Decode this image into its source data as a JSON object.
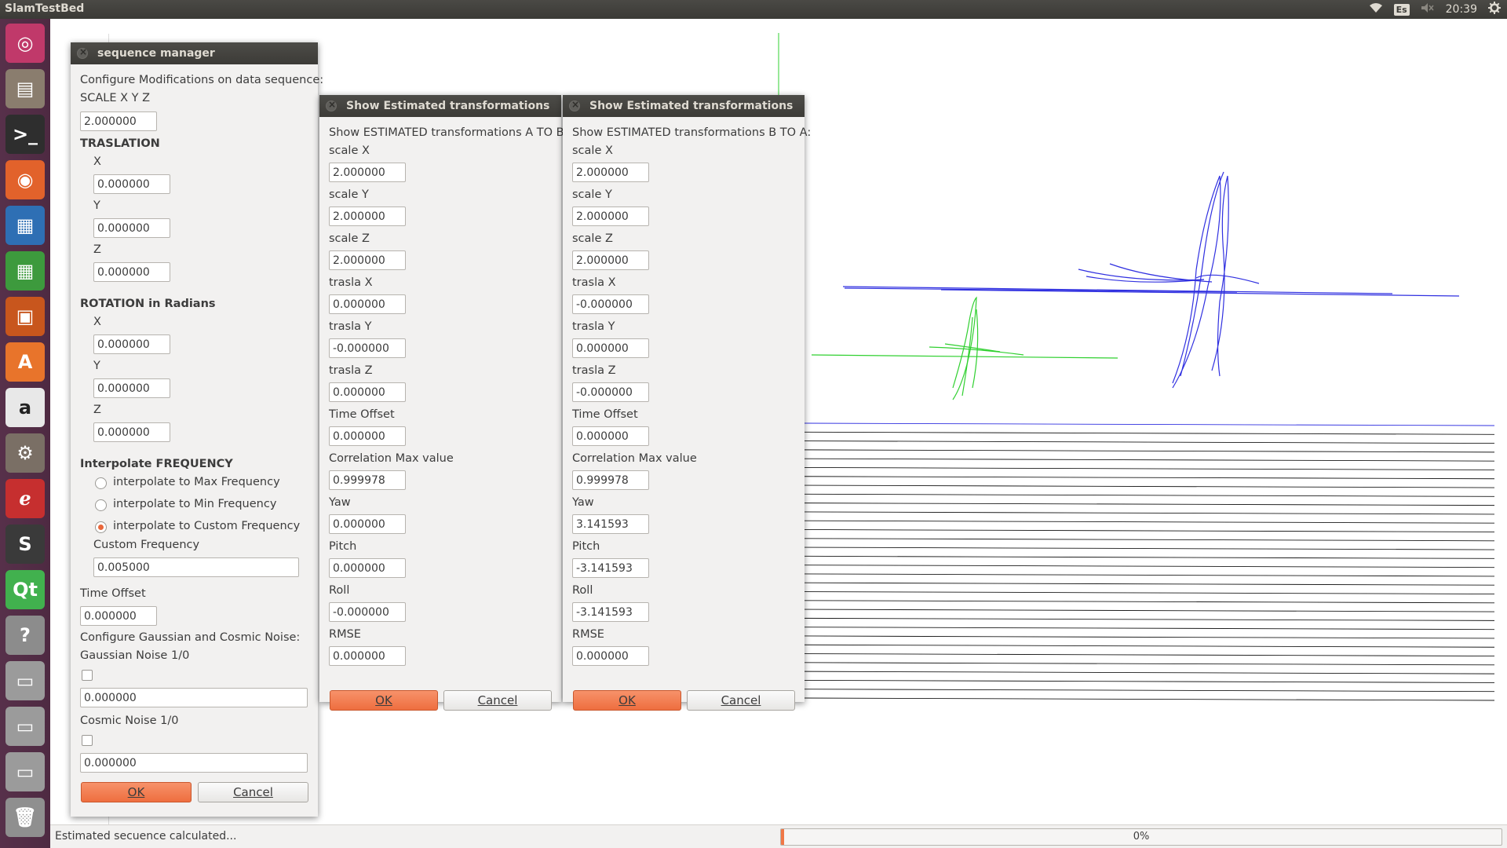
{
  "top_panel": {
    "app_title": "SlamTestBed",
    "keyboard_layout": "Es",
    "clock": "20:39",
    "icons": [
      "wifi-icon",
      "keyboard-icon",
      "volume-muted-icon",
      "gear-icon"
    ]
  },
  "launcher": {
    "items": [
      {
        "name": "ubuntu-dash-icon",
        "color": "#c0396a",
        "glyph": "◎"
      },
      {
        "name": "files-icon",
        "color": "#8a7d6e",
        "glyph": "▤"
      },
      {
        "name": "terminal-icon",
        "color": "#2e2e2e",
        "glyph": ">_"
      },
      {
        "name": "firefox-icon",
        "color": "#e2622b",
        "glyph": "◉"
      },
      {
        "name": "writer-icon",
        "color": "#2e6fb4",
        "glyph": "▦"
      },
      {
        "name": "calc-icon",
        "color": "#3d9a3d",
        "glyph": "▦"
      },
      {
        "name": "impress-icon",
        "color": "#c8561d",
        "glyph": "▣"
      },
      {
        "name": "software-center-icon",
        "color": "#e8742b",
        "glyph": "A"
      },
      {
        "name": "amazon-icon",
        "color": "#e8e8e8",
        "glyph": "a"
      },
      {
        "name": "system-settings-icon",
        "color": "#7a6f65",
        "glyph": "⚙"
      },
      {
        "name": "pdf-reader-icon",
        "color": "#c62f2f",
        "glyph": "ℯ"
      },
      {
        "name": "sublime-text-icon",
        "color": "#3a3a3a",
        "glyph": "S"
      },
      {
        "name": "qt-creator-icon",
        "color": "#41b14e",
        "glyph": "Qt"
      },
      {
        "name": "help-icon",
        "color": "#8c8c8c",
        "glyph": "?"
      },
      {
        "name": "drive-icon",
        "color": "#9b9b9b",
        "glyph": "▭"
      },
      {
        "name": "drive-icon-2",
        "color": "#9b9b9b",
        "glyph": "▭"
      },
      {
        "name": "drive-icon-3",
        "color": "#9b9b9b",
        "glyph": "▭"
      },
      {
        "name": "trash-icon",
        "color": "#8f8f8f",
        "glyph": "🗑"
      }
    ]
  },
  "status": {
    "text": "Estimated secuence calculated...",
    "progress_label": "0%",
    "progress_fraction": 0.004
  },
  "colors": {
    "accent": "#ee6e3f",
    "trajectory_a": "#3030e0",
    "trajectory_b": "#30d030",
    "scan_lines": "#1a1a1a"
  },
  "sequence_manager": {
    "title": "sequence manager",
    "intro": "Configure Modifications on data sequence:",
    "scale_label": "SCALE X Y Z",
    "scale_value": "2.000000",
    "translation_header": "TRASLATION",
    "tx_label": "X",
    "tx_value": "0.000000",
    "ty_label": "Y",
    "ty_value": "0.000000",
    "tz_label": "Z",
    "tz_value": "0.000000",
    "rotation_header": "ROTATION in Radians",
    "rx_label": "X",
    "rx_value": "0.000000",
    "ry_label": "Y",
    "ry_value": "0.000000",
    "rz_label": "Z",
    "rz_value": "0.000000",
    "interp_header": "Interpolate FREQUENCY",
    "radio_max": "interpolate to Max Frequency",
    "radio_min": "interpolate to Min Frequency",
    "radio_custom": "interpolate to Custom Frequency",
    "custom_freq_label": "Custom Frequency",
    "custom_freq_value": "0.005000",
    "time_offset_label": "Time Offset",
    "time_offset_value": "0.000000",
    "noise_intro": "Configure Gaussian and Cosmic Noise:",
    "gaussian_label": "Gaussian Noise 1/0",
    "gaussian_value": "0.000000",
    "cosmic_label": "Cosmic Noise 1/0",
    "cosmic_value": "0.000000",
    "ok_label": "OK",
    "cancel_label": "Cancel"
  },
  "est_a_to_b": {
    "title": "Show Estimated transformations",
    "intro": "Show ESTIMATED transformations A TO B:",
    "fields": [
      {
        "label": "scale X",
        "value": "2.000000"
      },
      {
        "label": "scale Y",
        "value": "2.000000"
      },
      {
        "label": "scale Z",
        "value": "2.000000"
      },
      {
        "label": "trasla X",
        "value": "0.000000"
      },
      {
        "label": "trasla Y",
        "value": "-0.000000"
      },
      {
        "label": "trasla Z",
        "value": "0.000000"
      },
      {
        "label": "Time Offset",
        "value": "0.000000"
      },
      {
        "label": "Correlation Max value",
        "value": "0.999978"
      },
      {
        "label": "Yaw",
        "value": "0.000000"
      },
      {
        "label": "Pitch",
        "value": "0.000000"
      },
      {
        "label": "Roll",
        "value": "-0.000000"
      },
      {
        "label": "RMSE",
        "value": "0.000000"
      }
    ],
    "ok_label": "OK",
    "cancel_label": "Cancel"
  },
  "est_b_to_a": {
    "title": "Show Estimated transformations",
    "intro": "Show ESTIMATED transformations B TO A:",
    "fields": [
      {
        "label": "scale X",
        "value": "2.000000"
      },
      {
        "label": "scale Y",
        "value": "2.000000"
      },
      {
        "label": "scale Z",
        "value": "2.000000"
      },
      {
        "label": "trasla X",
        "value": "-0.000000"
      },
      {
        "label": "trasla Y",
        "value": "0.000000"
      },
      {
        "label": "trasla Z",
        "value": "-0.000000"
      },
      {
        "label": "Time Offset",
        "value": "0.000000"
      },
      {
        "label": "Correlation Max value",
        "value": "0.999978"
      },
      {
        "label": "Yaw",
        "value": "3.141593"
      },
      {
        "label": "Pitch",
        "value": "-3.141593"
      },
      {
        "label": "Roll",
        "value": "-3.141593"
      },
      {
        "label": "RMSE",
        "value": "0.000000"
      }
    ],
    "ok_label": "OK",
    "cancel_label": "Cancel"
  }
}
